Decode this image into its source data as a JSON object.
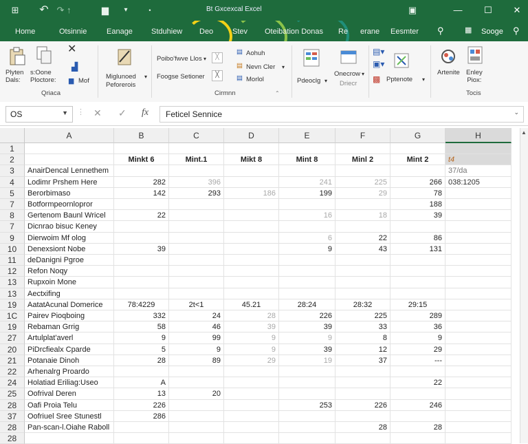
{
  "titlebar": {
    "title": "Bt Gxcexcal Excel",
    "app_icon": "excel-grid-icon",
    "minimize": "—",
    "maximize": "☐",
    "close": "✕"
  },
  "tabs": [
    "Home",
    "Otsinnie",
    "Eanage",
    "Stduhiew",
    "Deo",
    "Stev",
    "Oteibation Donas",
    "Re",
    "erane",
    "Eesmter"
  ],
  "tabs_right": {
    "search_label": "Sooge"
  },
  "ribbon": {
    "clipboard": {
      "paste_label": "Plyten\nDals:",
      "format_label": "s:Oone\nPloctore:",
      "cut_label": "Mof",
      "group": "Qriaca"
    },
    "font": {
      "label1": "Miglunoed",
      "label2": "Peforerois"
    },
    "alignment": {
      "label1": "Poibo'fwve Llos",
      "label2": "Foogse Setioner",
      "group": "Cirmnn"
    },
    "number": {
      "item1": "Aohuh",
      "item2": "Nevn Cler",
      "item3": "Morlol"
    },
    "styles": {
      "label": "Pdeoclg"
    },
    "cells": {
      "label1": "Onecrow",
      "label2": "Driecr"
    },
    "editing": {
      "label": "Pptenote"
    },
    "tools": {
      "label1": "Artenite",
      "label2": "Enley\nPiox:",
      "group": "Tocis"
    }
  },
  "formula_bar": {
    "name_box": "OS",
    "fx": "fx",
    "content": "Feticel Sennice"
  },
  "columns": [
    "A",
    "B",
    "C",
    "D",
    "E",
    "F",
    "G",
    "H"
  ],
  "rows": [
    {
      "n": "1",
      "a": "",
      "b": "",
      "c": "",
      "d": "",
      "e": "",
      "f": "",
      "g": "",
      "h": ""
    },
    {
      "n": "2",
      "a": "",
      "b": "Minkt 6",
      "c": "Mint.1",
      "d": "Mikt 8",
      "e": "Mint 8",
      "f": "Minl 2",
      "g": "Mint 2",
      "h": "t4"
    },
    {
      "n": "3",
      "a": "AnairDencal Lennethem",
      "b": "",
      "c": "",
      "d": "",
      "e": "",
      "f": "",
      "g": "",
      "h": "37/da"
    },
    {
      "n": "4",
      "a": "Lodimr Prshem Here",
      "b": "282",
      "c": "396",
      "d": "",
      "e": "241",
      "f": "225",
      "g": "266",
      "h": "038:1205"
    },
    {
      "n": "5",
      "a": "Berorbimaso",
      "b": "142",
      "c": "293",
      "d": "186",
      "e": "199",
      "f": "29",
      "g": "78",
      "h": ""
    },
    {
      "n": "7",
      "a": "Botformpeornlopror",
      "b": "",
      "c": "",
      "d": "",
      "e": "",
      "f": "",
      "g": "188",
      "h": ""
    },
    {
      "n": "8",
      "a": "Gertenom Baunl Wricel",
      "b": "22",
      "c": "",
      "d": "",
      "e": "16",
      "f": "18",
      "g": "39",
      "h": ""
    },
    {
      "n": "7",
      "a": "Dicnrao bisuc Keney",
      "b": "",
      "c": "",
      "d": "",
      "e": "",
      "f": "",
      "g": "",
      "h": ""
    },
    {
      "n": "9",
      "a": "Dierwoim Mf olog",
      "b": "",
      "c": "",
      "d": "",
      "e": "6",
      "f": "22",
      "g": "86",
      "h": ""
    },
    {
      "n": "10",
      "a": "Denexsiont Nobe",
      "b": "39",
      "c": "",
      "d": "",
      "e": "9",
      "f": "43",
      "g": "131",
      "h": ""
    },
    {
      "n": "11",
      "a": "deDanigni Pgroe",
      "b": "",
      "c": "",
      "d": "",
      "e": "",
      "f": "",
      "g": "",
      "h": ""
    },
    {
      "n": "12",
      "a": "Refon Noqy",
      "b": "",
      "c": "",
      "d": "",
      "e": "",
      "f": "",
      "g": "",
      "h": ""
    },
    {
      "n": "13",
      "a": "Rupxoin Mone",
      "b": "",
      "c": "",
      "d": "",
      "e": "",
      "f": "",
      "g": "",
      "h": ""
    },
    {
      "n": "13",
      "a": "Aectxifing",
      "b": "",
      "c": "",
      "d": "",
      "e": "",
      "f": "",
      "g": "",
      "h": ""
    },
    {
      "n": "19",
      "a": "AatatAcunal Domerice",
      "b": "78:4229",
      "c": "2t<1",
      "d": "45.21",
      "e": "28:24",
      "f": "28:32",
      "g": "29:15",
      "h": ""
    },
    {
      "n": "1C",
      "a": "Pairev Pioqboing",
      "b": "332",
      "c": "24",
      "d": "28",
      "e": "226",
      "f": "225",
      "g": "289",
      "h": ""
    },
    {
      "n": "19",
      "a": "Rebaman Grrig",
      "b": "58",
      "c": "46",
      "d": "39",
      "e": "39",
      "f": "33",
      "g": "36",
      "h": ""
    },
    {
      "n": "27",
      "a": "Artulplat'averl",
      "b": "9",
      "c": "99",
      "d": "9",
      "e": "9",
      "f": "8",
      "g": "9",
      "h": ""
    },
    {
      "n": "20",
      "a": "PiDrcfiealx Cparde",
      "b": "5",
      "c": "9",
      "d": "9",
      "e": "39",
      "f": "12",
      "g": "29",
      "h": ""
    },
    {
      "n": "21",
      "a": "Potanaie Dinoh",
      "b": "28",
      "c": "89",
      "d": "29",
      "e": "19",
      "f": "37",
      "g": "---",
      "h": ""
    },
    {
      "n": "22",
      "a": "Arhenalrg Proardo",
      "b": "",
      "c": "",
      "d": "",
      "e": "",
      "f": "",
      "g": "",
      "h": ""
    },
    {
      "n": "24",
      "a": "Holatiad Eriliag:Useo",
      "b": "A",
      "c": "",
      "d": "",
      "e": "",
      "f": "",
      "g": "22",
      "h": ""
    },
    {
      "n": "25",
      "a": "Oofrival Deren",
      "b": "13",
      "c": "20",
      "d": "",
      "e": "",
      "f": "",
      "g": "",
      "h": ""
    },
    {
      "n": "28",
      "a": "Oafi Proia Telu",
      "b": "226",
      "c": "",
      "d": "",
      "e": "253",
      "f": "226",
      "g": "246",
      "h": ""
    },
    {
      "n": "37",
      "a": "Oofriuel Sree Stunestl",
      "b": "286",
      "c": "",
      "d": "",
      "e": "",
      "f": "",
      "g": "",
      "h": ""
    },
    {
      "n": "28",
      "a": "Pan-scan-l.Oiahe Raboll",
      "b": "",
      "c": "",
      "d": "",
      "e": "",
      "f": "28",
      "g": "28",
      "h": ""
    },
    {
      "n": "28",
      "a": "",
      "b": "",
      "c": "",
      "d": "",
      "e": "",
      "f": "",
      "g": "",
      "h": ""
    }
  ],
  "gray_cells": [
    "3.c",
    "3.e",
    "3.f",
    "4.d",
    "4.f",
    "6.e",
    "6.f",
    "8.e",
    "15.d",
    "16.d",
    "17.d",
    "17.e",
    "18.d",
    "19.d",
    "19.e"
  ],
  "colors": {
    "brand_green": "#1e6b3c",
    "swoosh_yellow": "#f3d117",
    "swoosh_lime": "#8bc34a",
    "swoosh_teal": "#1f8f7a",
    "selection": "#dadada"
  }
}
